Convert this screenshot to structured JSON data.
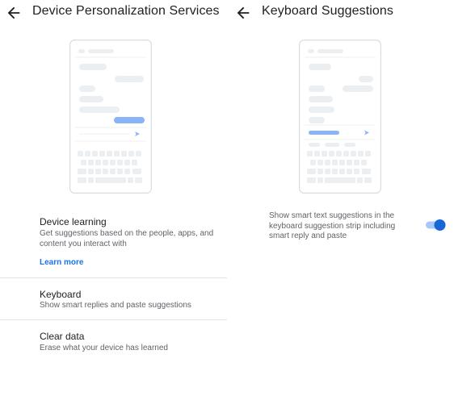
{
  "left_screen": {
    "title": "Device Personalization Services",
    "device_learning": {
      "title": "Device learning",
      "subtitle": "Get suggestions based on the people, apps, and content you interact with",
      "link": "Learn more"
    },
    "keyboard": {
      "title": "Keyboard",
      "subtitle": "Show smart replies and paste suggestions"
    },
    "clear_data": {
      "title": "Clear data",
      "subtitle": "Erase what your device has learned"
    }
  },
  "right_screen": {
    "title": "Keyboard Suggestions",
    "description": "Show smart text suggestions in the keyboard suggestion strip including smart reply and paste",
    "toggle_on": true
  },
  "icons": {
    "back": "arrow-back-icon",
    "send": "send-icon"
  },
  "colors": {
    "accent": "#1a73e8",
    "toggle_thumb": "#1967d2",
    "toggle_track": "#a8c7fa",
    "illustration_blue": "#8ab4f8",
    "illustration_grey": "#eceff1"
  }
}
